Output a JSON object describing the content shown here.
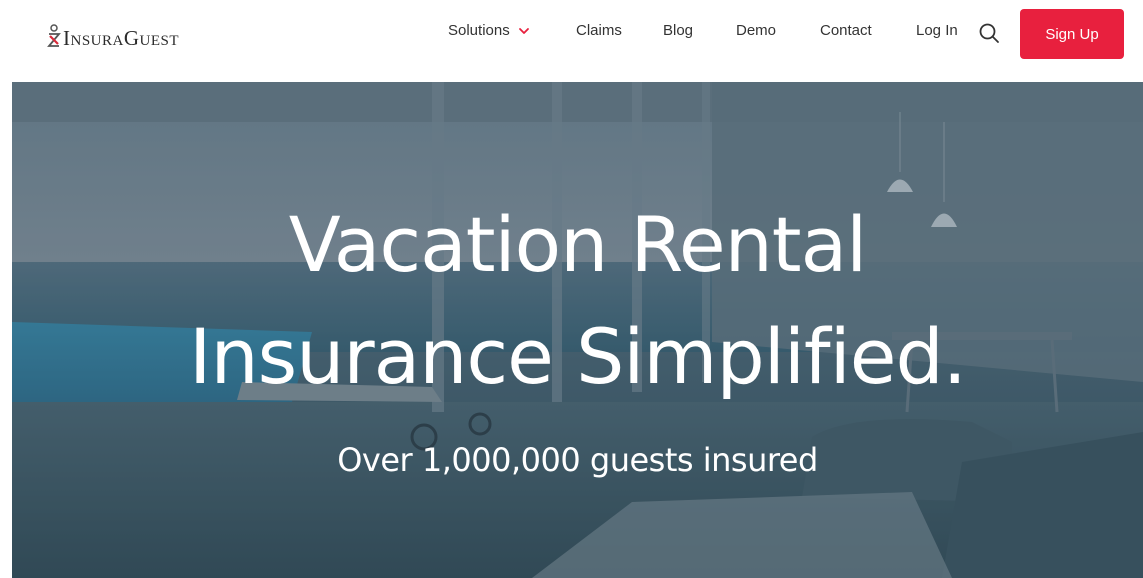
{
  "header": {
    "logo_text": "InsuraGuest",
    "nav": {
      "solutions": "Solutions",
      "claims": "Claims",
      "blog": "Blog",
      "demo": "Demo",
      "contact": "Contact",
      "login": "Log In"
    },
    "signup_label": "Sign Up",
    "icons": {
      "solutions_dropdown": "chevron-down-icon",
      "search": "search-icon",
      "logo": "logo-icon"
    }
  },
  "hero": {
    "title_line1": "Vacation Rental",
    "title_line2": "Insurance Simplified.",
    "subtitle": "Over 1,000,000 guests insured"
  },
  "colors": {
    "accent": "#e8203e",
    "text": "#333333",
    "hero_text": "#ffffff",
    "hero_tint": "#4e6a78"
  }
}
